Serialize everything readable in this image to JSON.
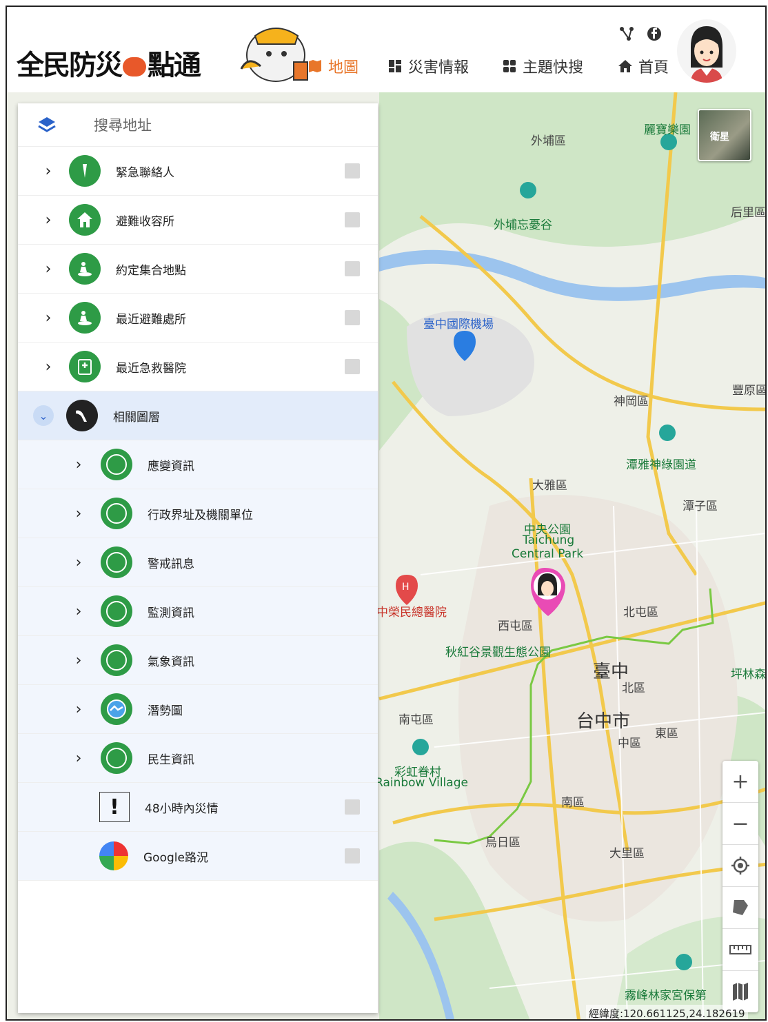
{
  "header": {
    "logo_text_1": "全民防災",
    "logo_text_2": "點通",
    "nav": [
      {
        "label": "地圖"
      },
      {
        "label": "災害情報"
      },
      {
        "label": "主題快搜"
      },
      {
        "label": "首頁"
      }
    ]
  },
  "panel": {
    "search_placeholder": "搜尋地址",
    "items": [
      {
        "label": "緊急聯絡人",
        "icon": "phone-icon"
      },
      {
        "label": "避難收容所",
        "icon": "house-icon"
      },
      {
        "label": "約定集合地點",
        "icon": "gathering-icon"
      },
      {
        "label": "最近避難處所",
        "icon": "shelter-icon"
      },
      {
        "label": "最近急救醫院",
        "icon": "hospital-icon"
      },
      {
        "label": "相關圖層",
        "icon": "layers-dark-icon"
      }
    ],
    "sub_items": [
      {
        "label": "應變資訊"
      },
      {
        "label": "行政界址及機關單位"
      },
      {
        "label": "警戒訊息"
      },
      {
        "label": "監測資訊"
      },
      {
        "label": "氣象資訊"
      },
      {
        "label": "潛勢圖"
      },
      {
        "label": "民生資訊"
      }
    ],
    "extra_items": [
      {
        "label": "48小時內災情"
      },
      {
        "label": "Google路況"
      }
    ]
  },
  "map": {
    "satellite_label": "衛星",
    "coordinate_text": "經緯度:120.661125,24.182619",
    "labels": [
      {
        "text": "外埔區"
      },
      {
        "text": "麗寶樂園"
      },
      {
        "text": "外埔忘憂谷"
      },
      {
        "text": "后里區"
      },
      {
        "text": "臺中國際機場"
      },
      {
        "text": "神岡區"
      },
      {
        "text": "豐原區"
      },
      {
        "text": "潭雅神綠園道"
      },
      {
        "text": "大雅區"
      },
      {
        "text": "潭子區"
      },
      {
        "text": "中央公園"
      },
      {
        "text": "Taichung"
      },
      {
        "text": "Central Park"
      },
      {
        "text": "中榮民總醫院"
      },
      {
        "text": "西屯區"
      },
      {
        "text": "北屯區"
      },
      {
        "text": "秋紅谷景觀生態公園"
      },
      {
        "text": "臺中"
      },
      {
        "text": "北區"
      },
      {
        "text": "台中市"
      },
      {
        "text": "南屯區"
      },
      {
        "text": "東區"
      },
      {
        "text": "中區"
      },
      {
        "text": "彩虹眷村"
      },
      {
        "text": "Rainbow Village"
      },
      {
        "text": "南區"
      },
      {
        "text": "烏日區"
      },
      {
        "text": "大里區"
      },
      {
        "text": "霧峰林家宮保第"
      },
      {
        "text": "坪林森"
      }
    ],
    "controls": [
      "+",
      "−"
    ]
  }
}
